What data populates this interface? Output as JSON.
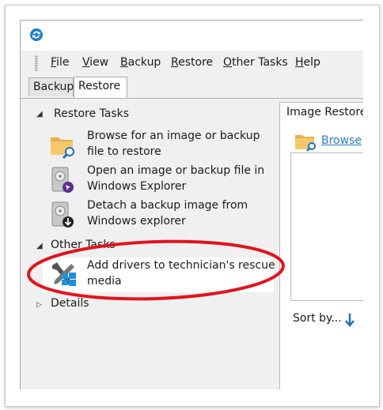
{
  "menu": {
    "items": [
      "File",
      "View",
      "Backup",
      "Restore",
      "Other Tasks",
      "Help"
    ]
  },
  "tabs": [
    {
      "label": "Backup",
      "active": false
    },
    {
      "label": "Restore",
      "active": true
    }
  ],
  "left_pane": {
    "restore_tasks_header": "Restore Tasks",
    "tasks": [
      {
        "label": "Browse for an image or backup file to restore",
        "icon": "folder-search-icon"
      },
      {
        "label": "Open an image or backup file in Windows Explorer",
        "icon": "disk-open-icon"
      },
      {
        "label": "Detach a backup image from Windows explorer",
        "icon": "disk-detach-icon"
      }
    ],
    "other_tasks_header": "Other Tasks",
    "other_tasks": [
      {
        "label": "Add drivers to technician's rescue media",
        "icon": "drivers-tools-icon"
      }
    ],
    "details_header": "Details"
  },
  "right_pane": {
    "title": "Image Restore",
    "browse_link": "Browse",
    "sort_label": "Sort by...",
    "sort_icon": "arrow-down-icon"
  },
  "colors": {
    "annotation_ellipse": "#e0141e",
    "link": "#2a7cc6",
    "window_bg": "#f0f0f0",
    "app_icon": "#1e7fd0"
  }
}
